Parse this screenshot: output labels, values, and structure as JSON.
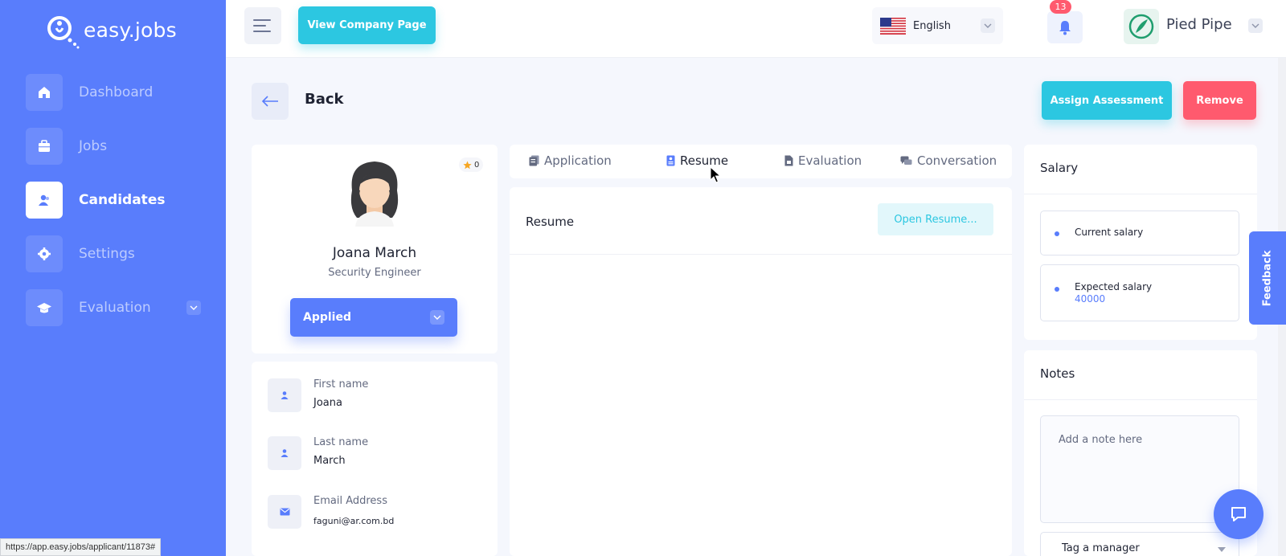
{
  "app": {
    "name": "easy.jobs"
  },
  "sidebar": {
    "items": [
      {
        "label": "Dashboard",
        "icon": "home-icon"
      },
      {
        "label": "Jobs",
        "icon": "briefcase-icon"
      },
      {
        "label": "Candidates",
        "icon": "users-icon",
        "active": true
      },
      {
        "label": "Settings",
        "icon": "gear-icon"
      },
      {
        "label": "Evaluation",
        "icon": "graduation-cap-icon"
      }
    ]
  },
  "topbar": {
    "view_company_label": "View Company Page",
    "language": "English",
    "notifications_count": "13",
    "company_name": "Pied Pipe"
  },
  "header": {
    "back_label": "Back",
    "assign_label": "Assign Assessment",
    "remove_label": "Remove"
  },
  "candidate": {
    "rating": "0",
    "name": "Joana March",
    "title": "Security Engineer",
    "status": "Applied",
    "fields": [
      {
        "label": "First name",
        "value": "Joana"
      },
      {
        "label": "Last name",
        "value": "March"
      },
      {
        "label": "Email Address",
        "value": "faguni@ar.com.bd"
      }
    ]
  },
  "tabs": [
    "Application",
    "Resume",
    "Evaluation",
    "Conversation"
  ],
  "resume": {
    "title": "Resume",
    "open_label": "Open Resume..."
  },
  "salary": {
    "title": "Salary",
    "current_label": "Current salary",
    "expected_label": "Expected salary",
    "expected_value": "40000"
  },
  "notes": {
    "title": "Notes",
    "placeholder": "Add a note here",
    "tag_manager_label": "Tag a manager"
  },
  "feedback_label": "Feedback",
  "status_url": "https://app.easy.jobs/applicant/11873#",
  "colors": {
    "primary": "#597dfc",
    "accent": "#2cc7e1",
    "danger": "#ff5a6e"
  }
}
